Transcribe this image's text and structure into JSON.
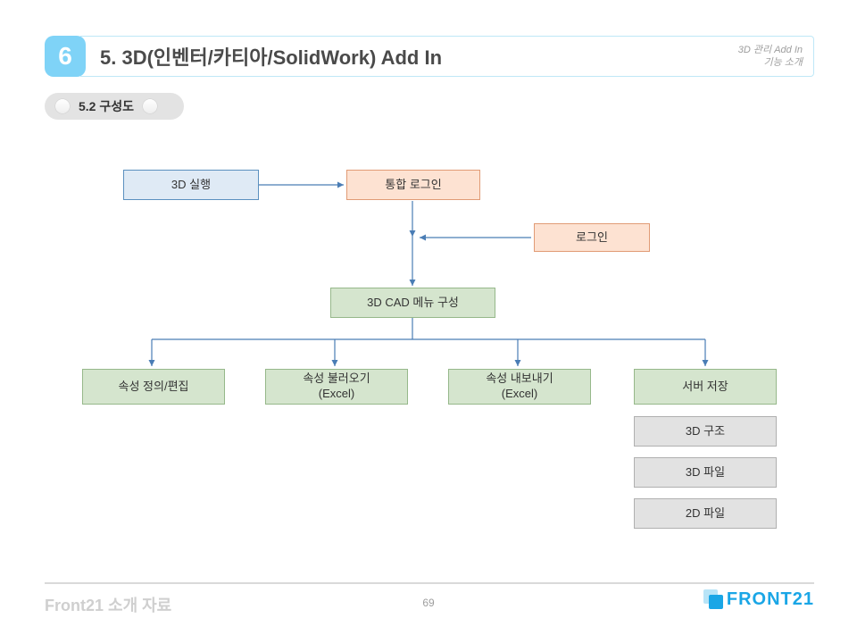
{
  "header": {
    "chapter_number": "6",
    "title": "5. 3D(인벤터/카티아/SolidWork) Add In",
    "note_line1": "3D 관리 Add In",
    "note_line2": "기능 소개"
  },
  "subheader": {
    "text": "5.2 구성도"
  },
  "diagram": {
    "nodes": {
      "run3d": "3D 실행",
      "unified_login": "통합 로그인",
      "login": "로그인",
      "menu": "3D CAD 메뉴 구성",
      "attr_edit": "속성 정의/편집",
      "attr_import": "속성 불러오기\n(Excel)",
      "attr_export": "속성 내보내기\n(Excel)",
      "server_save": "서버 저장",
      "tree3d": "3D 구조",
      "file3d": "3D 파일",
      "file2d": "2D 파일"
    }
  },
  "footer": {
    "left": "Front21 소개 자료",
    "page": "69",
    "logo_text": "FRONT21"
  },
  "colors": {
    "accent": "#1aa6e6",
    "badge": "#7fd3f7",
    "edge": "#4a7db5"
  }
}
